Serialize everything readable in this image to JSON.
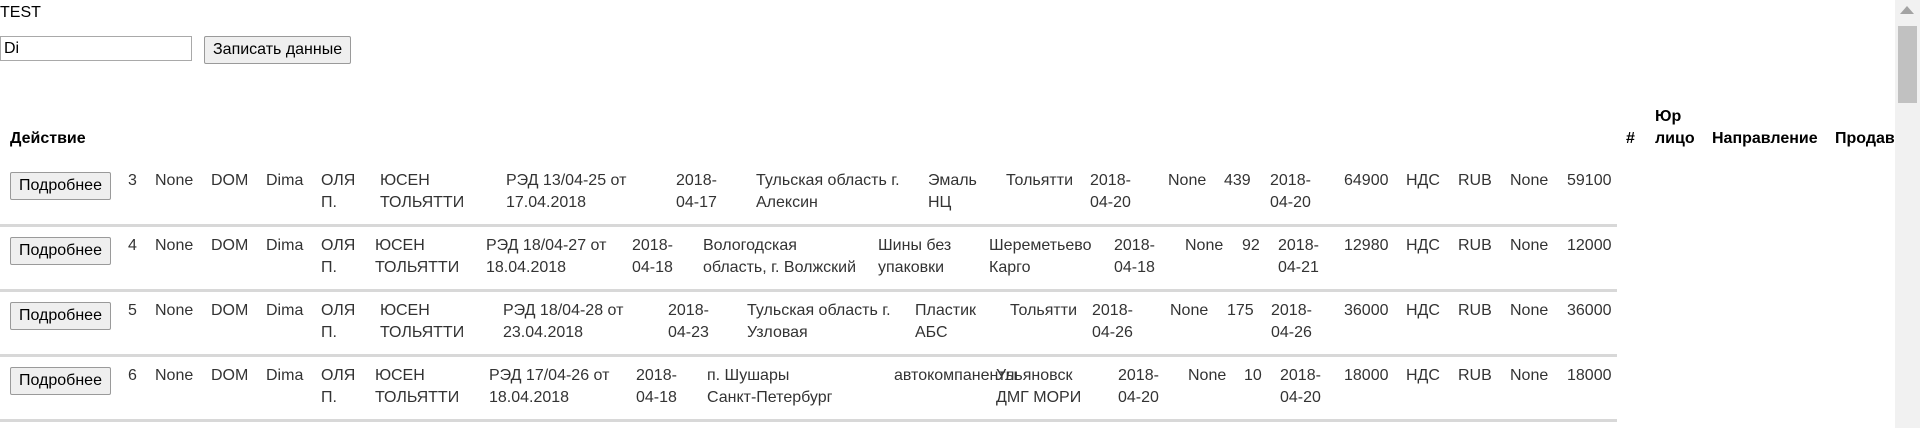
{
  "page": {
    "title": "TEST"
  },
  "form": {
    "input_value": "Di",
    "save_label": "Записать данные"
  },
  "table": {
    "headers": {
      "action": "Действие",
      "num": "#",
      "legal1": "Юр",
      "legal2": "лицо",
      "direction": "Направление",
      "seller": "Продавец"
    },
    "detail_label": "Подробнее",
    "rows": [
      {
        "id": "3",
        "f1": "None",
        "f2": "DOM",
        "f3": "Dima",
        "m1": "ОЛЯ",
        "m2": "П.",
        "c1": "ЮСЕН",
        "c2": "ТОЛЬЯТТИ",
        "r1": "РЭД 13/04-25 от",
        "r2": "17.04.2018",
        "d1a": "2018-",
        "d1b": "04-17",
        "o1": "Тульская область г.",
        "o2": "Алексин",
        "g1": "Эмаль",
        "g2": "НЦ",
        "dest1": "Тольятти",
        "dest2": "",
        "d2a": "2018-",
        "d2b": "04-20",
        "n1": "None",
        "n2": "439",
        "d3a": "2018-",
        "d3b": "04-20",
        "price": "64900",
        "vat": "НДС",
        "cur": "RUB",
        "n3": "None",
        "total": "59100"
      },
      {
        "id": "4",
        "f1": "None",
        "f2": "DOM",
        "f3": "Dima",
        "m1": "ОЛЯ",
        "m2": "П.",
        "c1": "ЮСЕН",
        "c2": "ТОЛЬЯТТИ",
        "r1": "РЭД 18/04-27 от",
        "r2": "18.04.2018",
        "d1a": "2018-",
        "d1b": "04-18",
        "o1": "Вологодская",
        "o2": "область, г. Волжский",
        "g1": "Шины без",
        "g2": "упаковки",
        "dest1": "Шереметьево",
        "dest2": "Карго",
        "d2a": "2018-",
        "d2b": "04-18",
        "n1": "None",
        "n2": "92",
        "d3a": "2018-",
        "d3b": "04-21",
        "price": "12980",
        "vat": "НДС",
        "cur": "RUB",
        "n3": "None",
        "total": "12000"
      },
      {
        "id": "5",
        "f1": "None",
        "f2": "DOM",
        "f3": "Dima",
        "m1": "ОЛЯ",
        "m2": "П.",
        "c1": "ЮСЕН",
        "c2": "ТОЛЬЯТТИ",
        "r1": "РЭД 18/04-28 от",
        "r2": "23.04.2018",
        "d1a": "2018-",
        "d1b": "04-23",
        "o1": "Тульская область г.",
        "o2": "Узловая",
        "g1": "Пластик",
        "g2": "АБС",
        "dest1": "Тольятти",
        "dest2": "",
        "d2a": "2018-",
        "d2b": "04-26",
        "n1": "None",
        "n2": "175",
        "d3a": "2018-",
        "d3b": "04-26",
        "price": "36000",
        "vat": "НДС",
        "cur": "RUB",
        "n3": "None",
        "total": "36000"
      },
      {
        "id": "6",
        "f1": "None",
        "f2": "DOM",
        "f3": "Dima",
        "m1": "ОЛЯ",
        "m2": "П.",
        "c1": "ЮСЕН",
        "c2": "ТОЛЬЯТТИ",
        "r1": "РЭД 17/04-26 от",
        "r2": "18.04.2018",
        "d1a": "2018-",
        "d1b": "04-18",
        "o1": "п. Шушары",
        "o2": "Санкт-Петербург",
        "g1": "автокомпаненты",
        "g2": "",
        "dest1": "Ульяновск",
        "dest2": "ДМГ МОРИ",
        "d2a": "2018-",
        "d2b": "04-20",
        "n1": "None",
        "n2": "10",
        "d3a": "2018-",
        "d3b": "04-20",
        "price": "18000",
        "vat": "НДС",
        "cur": "RUB",
        "n3": "None",
        "total": "18000"
      }
    ]
  }
}
